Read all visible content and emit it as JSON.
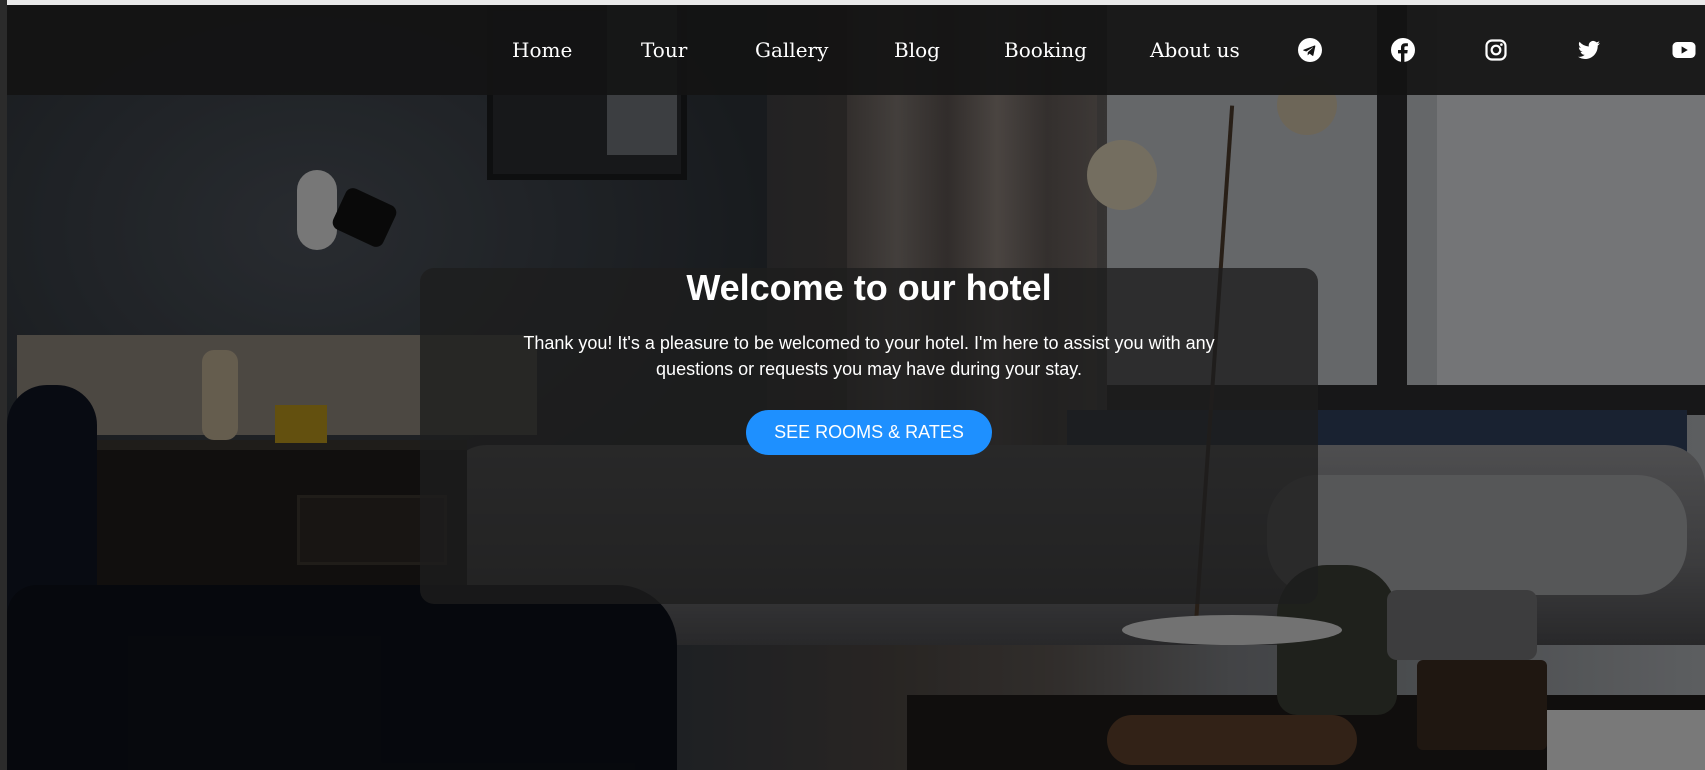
{
  "nav": {
    "links": [
      {
        "label": "Home"
      },
      {
        "label": "Tour"
      },
      {
        "label": "Gallery"
      },
      {
        "label": "Blog"
      },
      {
        "label": "Booking"
      },
      {
        "label": "About us"
      }
    ],
    "social_icons": [
      "telegram-icon",
      "facebook-icon",
      "instagram-icon",
      "twitter-icon",
      "youtube-icon"
    ]
  },
  "hero": {
    "title": "Welcome to our hotel",
    "text": "Thank you! It's a pleasure to be welcomed to your hotel. I'm here to assist you with any questions or requests you may have during your stay.",
    "cta_label": "SEE ROOMS & RATES"
  },
  "colors": {
    "cta_background": "#1e90ff",
    "navbar_background": "#141414",
    "text": "#ffffff"
  }
}
